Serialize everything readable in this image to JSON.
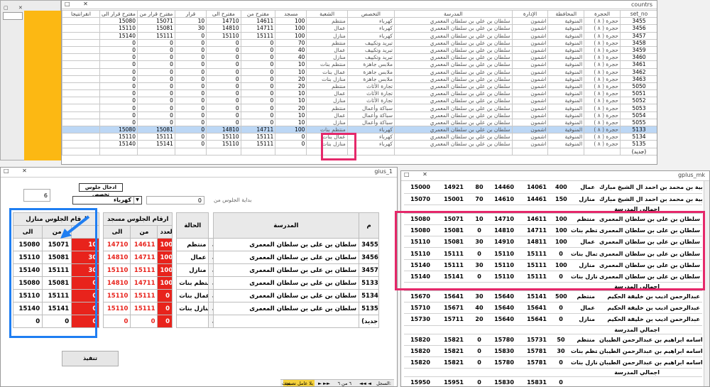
{
  "top_window": {
    "title": "countrs",
    "columns": [
      "set_no",
      "الحجرة",
      "المحافظة",
      "الإدارة",
      "المدرسة",
      "التخصص",
      "الشعبة",
      "مسجد",
      "مقترح من",
      "مقترح الى",
      "قرار",
      "مقترح قرار من",
      "مقترح قرار الى",
      "انقرانتيجا"
    ],
    "rows": [
      [
        "3455",
        "حجرة ( ٨ )",
        "المنوفية",
        "اشمون",
        "سلطان بن علي بن سلطان المعمري",
        "كهرباء",
        "منتظم",
        "100",
        "14611",
        "14710",
        "10",
        "15071",
        "15080",
        ""
      ],
      [
        "3456",
        "حجرة ( ٨ )",
        "المنوفية",
        "اشمون",
        "سلطان بن علي بن سلطان المعمري",
        "كهرباء",
        "عمال",
        "100",
        "14711",
        "14810",
        "30",
        "15081",
        "15110",
        ""
      ],
      [
        "3457",
        "حجرة ( ٨ )",
        "المنوفية",
        "اشمون",
        "سلطان بن علي بن سلطان المعمري",
        "كهرباء",
        "منازل",
        "100",
        "15111",
        "15110",
        "0",
        "15111",
        "15140",
        ""
      ],
      [
        "3458",
        "حجرة ( ٨ )",
        "المنوفية",
        "اشمون",
        "سلطان بن علي بن سلطان المعمري",
        "تبريد وتكييف",
        "منتظم",
        "70",
        "0",
        "0",
        "0",
        "0",
        "0",
        ""
      ],
      [
        "3459",
        "حجرة ( ٨ )",
        "المنوفية",
        "اشمون",
        "سلطان بن علي بن سلطان المعمري",
        "تبريد وتكييف",
        "عمال",
        "40",
        "0",
        "0",
        "0",
        "0",
        "0",
        ""
      ],
      [
        "3460",
        "حجرة ( ٨ )",
        "المنوفية",
        "اشمون",
        "سلطان بن علي بن سلطان المعمري",
        "تبريد وتكييف",
        "منازل",
        "40",
        "0",
        "0",
        "0",
        "0",
        "0",
        ""
      ],
      [
        "3461",
        "حجرة ( ٨ )",
        "المنوفية",
        "اشمون",
        "سلطان بن علي بن سلطان المعمري",
        "ملابس جاهزة",
        "منتظم بنات",
        "10",
        "0",
        "0",
        "0",
        "0",
        "0",
        ""
      ],
      [
        "3462",
        "حجرة ( ٨ )",
        "المنوفية",
        "اشمون",
        "سلطان بن علي بن سلطان المعمري",
        "ملابس جاهزة",
        "عمال بنات",
        "10",
        "0",
        "0",
        "0",
        "0",
        "0",
        ""
      ],
      [
        "3463",
        "حجرة ( ٨ )",
        "المنوفية",
        "اشمون",
        "سلطان بن علي بن سلطان المعمري",
        "ملابس جاهزة",
        "منازل بنات",
        "20",
        "0",
        "0",
        "0",
        "0",
        "0",
        ""
      ],
      [
        "5050",
        "حجرة ( ٨ )",
        "المنوفية",
        "اشمون",
        "سلطان بن علي بن سلطان المعمري",
        "تجارة الأثاث",
        "منتظم",
        "20",
        "0",
        "0",
        "0",
        "0",
        "0",
        ""
      ],
      [
        "5051",
        "حجرة ( ٨ )",
        "المنوفية",
        "اشمون",
        "سلطان بن علي بن سلطان المعمري",
        "تجارة الأثاث",
        "عمال",
        "10",
        "0",
        "0",
        "0",
        "0",
        "0",
        ""
      ],
      [
        "5052",
        "حجرة ( ٨ )",
        "المنوفية",
        "اشمون",
        "سلطان بن علي بن سلطان المعمري",
        "تجارة الأثاث",
        "منازل",
        "10",
        "0",
        "0",
        "0",
        "0",
        "0",
        ""
      ],
      [
        "5053",
        "حجرة ( ٨ )",
        "المنوفية",
        "اشمون",
        "سلطان بن علي بن سلطان المعمري",
        "سباكة وأعمال",
        "منتظم",
        "20",
        "0",
        "0",
        "0",
        "0",
        "0",
        ""
      ],
      [
        "5054",
        "حجرة ( ٨ )",
        "المنوفية",
        "اشمون",
        "سلطان بن علي بن سلطان المعمري",
        "سباكة وأعمال",
        "عمال",
        "10",
        "0",
        "0",
        "0",
        "0",
        "0",
        ""
      ],
      [
        "5055",
        "حجرة ( ٨ )",
        "المنوفية",
        "اشمون",
        "سلطان بن علي بن سلطان المعمري",
        "سباكة وأعمال",
        "منازل",
        "10",
        "0",
        "0",
        "0",
        "0",
        "0",
        ""
      ],
      [
        "5133",
        "حجرة ( ٨ )",
        "المنوفية",
        "اشمون",
        "سلطان بن علي بن سلطان المعمري",
        "كهرباء",
        "منتظم بنات",
        "100",
        "14711",
        "14810",
        "0",
        "15081",
        "15080",
        ""
      ],
      [
        "5134",
        "حجرة ( ٨ )",
        "المنوفية",
        "اشمون",
        "سلطان بن علي بن سلطان المعمري",
        "كهرباء",
        "عمال بنات",
        "0",
        "15111",
        "15110",
        "0",
        "15111",
        "15110",
        ""
      ],
      [
        "5135",
        "حجرة ( ٨ )",
        "المنوفية",
        "اشمون",
        "سلطان بن علي بن سلطان المعمري",
        "كهرباء",
        "منازل بنات",
        "0",
        "15111",
        "15110",
        "0",
        "15141",
        "15140",
        ""
      ],
      [
        "(جديد)",
        "",
        "",
        "",
        "",
        "",
        "",
        "",
        "",
        "",
        "",
        "",
        "",
        ""
      ]
    ]
  },
  "form_window": {
    "title": "gius_1",
    "input_value": "6",
    "header_label": "ادخال جلوس تخصص",
    "specialty_value": "كهرباء",
    "start_label": "بداية الجلوس من",
    "start_value": "0",
    "groups": {
      "part_a": "ارقام الجلوس منازل",
      "part_b": "ارقام الجلوس مسجد"
    },
    "columns": {
      "to": "الى",
      "from": "من",
      "count": "العدد",
      "status": "الحالة",
      "school": "المدرسة",
      "no": "م"
    },
    "rows": [
      {
        "a_to": "15080",
        "a_from": "15071",
        "a_n": "10",
        "b_to": "14710",
        "b_from": "14611",
        "b_n": "100",
        "status": "منتظم",
        "school": "سلطان بن على بن سلطان المعمرى",
        "no": "3455"
      },
      {
        "a_to": "15110",
        "a_from": "15081",
        "a_n": "30",
        "b_to": "14810",
        "b_from": "14711",
        "b_n": "100",
        "status": "عمال",
        "school": "سلطان بن على بن سلطان المعمرى",
        "no": "3456"
      },
      {
        "a_to": "15140",
        "a_from": "15111",
        "a_n": "30",
        "b_to": "15110",
        "b_from": "15111",
        "b_n": "100",
        "status": "منازل",
        "school": "سلطان بن على بن سلطان المعمرى",
        "no": "3457"
      },
      {
        "a_to": "15080",
        "a_from": "15081",
        "a_n": "0",
        "b_to": "14810",
        "b_from": "14711",
        "b_n": "100",
        "status": "منتظم بنات",
        "school": "سلطان بن على بن سلطان المعمرى",
        "no": "5133"
      },
      {
        "a_to": "15110",
        "a_from": "15111",
        "a_n": "0",
        "b_to": "15110",
        "b_from": "15111",
        "b_n": "0",
        "status": "عمال بنات",
        "school": "سلطان بن على بن سلطان المعمرى",
        "no": "5134"
      },
      {
        "a_to": "15140",
        "a_from": "15141",
        "a_n": "0",
        "b_to": "15110",
        "b_from": "15111",
        "b_n": "0",
        "status": "منازل بنات",
        "school": "سلطان بن على بن سلطان المعمرى",
        "no": "5135"
      },
      {
        "a_to": "0",
        "a_from": "0",
        "a_n": "0",
        "b_to": "0",
        "b_from": "0",
        "b_n": "0",
        "status": "",
        "school": "",
        "no": "(جديد)"
      }
    ],
    "execute_label": "تنفيذ",
    "nav": {
      "record_label": "السجل:",
      "record_pos": "٦ من ٦",
      "filter_label": "بلا عامل تصفية",
      "search_label": "بحث"
    }
  },
  "report_window": {
    "title": "gplus_mk",
    "rows": [
      {
        "type": "d",
        "c1": "15000",
        "c2": "14921",
        "c3": "80",
        "c4": "14460",
        "c5": "14061",
        "c6": "400",
        "status": "عمال",
        "school": "قنبية بن محمد بن احمد ال الشيخ مبارك"
      },
      {
        "type": "d",
        "c1": "15070",
        "c2": "15001",
        "c3": "70",
        "c4": "14610",
        "c5": "14461",
        "c6": "150",
        "status": "منازل",
        "school": "قنبية بن محمد بن احمد ال الشيخ مبارك"
      },
      {
        "type": "h",
        "school": "اجمالي المدرسة"
      },
      {
        "type": "d",
        "c1": "15080",
        "c2": "15071",
        "c3": "10",
        "c4": "14710",
        "c5": "14611",
        "c6": "100",
        "status": "منتظم",
        "school": "سلطان بن على بن سلطان المعمرى"
      },
      {
        "type": "d",
        "c1": "15080",
        "c2": "15081",
        "c3": "0",
        "c4": "14810",
        "c5": "14711",
        "c6": "100",
        "status": "منتظم بنات",
        "school": "سلطان بن على بن سلطان المعمرى"
      },
      {
        "type": "d",
        "c1": "15110",
        "c2": "15081",
        "c3": "30",
        "c4": "14910",
        "c5": "14811",
        "c6": "100",
        "status": "عمال",
        "school": "سلطان بن على بن سلطان المعمرى"
      },
      {
        "type": "d",
        "c1": "15110",
        "c2": "15111",
        "c3": "0",
        "c4": "15110",
        "c5": "15111",
        "c6": "0",
        "status": "عمال بنات",
        "school": "سلطان بن على بن سلطان المعمرى"
      },
      {
        "type": "d",
        "c1": "15140",
        "c2": "15111",
        "c3": "30",
        "c4": "15110",
        "c5": "15111",
        "c6": "100",
        "status": "منازل",
        "school": "سلطان بن على بن سلطان المعمرى"
      },
      {
        "type": "d",
        "c1": "15140",
        "c2": "15141",
        "c3": "0",
        "c4": "15110",
        "c5": "15111",
        "c6": "0",
        "status": "منازل بنات",
        "school": "سلطان بن على بن سلطان المعمرى"
      },
      {
        "type": "h",
        "school": "اجمالي المدرسة"
      },
      {
        "type": "d",
        "c1": "15670",
        "c2": "15641",
        "c3": "30",
        "c4": "15640",
        "c5": "15141",
        "c6": "500",
        "status": "منتظم",
        "school": "عبدالرحمن اديب بن خليفة الحكيم"
      },
      {
        "type": "d",
        "c1": "15710",
        "c2": "15671",
        "c3": "40",
        "c4": "15640",
        "c5": "15641",
        "c6": "0",
        "status": "عمال",
        "school": "عبدالرحمن اديب بن خليفة الحكيم"
      },
      {
        "type": "d",
        "c1": "15730",
        "c2": "15711",
        "c3": "20",
        "c4": "15640",
        "c5": "15641",
        "c6": "0",
        "status": "منازل",
        "school": "عبدالرحمن اديب بن خليفة الحكيم"
      },
      {
        "type": "h",
        "school": "اجمالي المدرسة"
      },
      {
        "type": "d",
        "c1": "15820",
        "c2": "15821",
        "c3": "0",
        "c4": "15780",
        "c5": "15731",
        "c6": "50",
        "status": "منتظم",
        "school": "اسامه ابراهيم بن عبدالرحمن الطيبان"
      },
      {
        "type": "d",
        "c1": "15820",
        "c2": "15821",
        "c3": "0",
        "c4": "15830",
        "c5": "15781",
        "c6": "30",
        "status": "منتظم بنات",
        "school": "اسامه ابراهيم بن عبدالرحمن الطيبان"
      },
      {
        "type": "d",
        "c1": "15820",
        "c2": "15821",
        "c3": "0",
        "c4": "15780",
        "c5": "15781",
        "c6": "0",
        "status": "منازل بنات",
        "school": "اسامه ابراهيم بن عبدالرحمن الطيبان"
      },
      {
        "type": "h",
        "school": "اجمالي المدرسة"
      },
      {
        "type": "d",
        "c1": "15950",
        "c2": "15951",
        "c3": "0",
        "c4": "15830",
        "c5": "15831",
        "c6": "0",
        "status": "",
        "school": ""
      }
    ]
  }
}
